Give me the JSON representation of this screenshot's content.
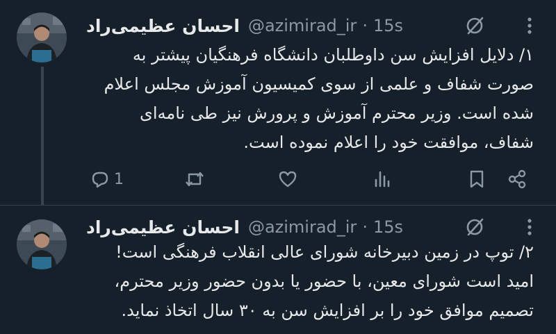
{
  "tweets": [
    {
      "author_name": "احسان عظیمی‌راد",
      "handle": "@azimirad_ir",
      "separator": "·",
      "time": "15s",
      "text": "۱/ دلایل افزایش سن داوطلبان دانشگاه فرهنگیان پیشتر به\nصورت شفاف و علمی از سوی کمیسیون آموزش مجلس اعلام\nشده است. وزیر محترم آموزش و پرورش نیز طی نامه‌ای\nشفاف، موافقت خود را اعلام نموده است.",
      "reply_count": "1",
      "icons": [
        "grok-icon",
        "more-icon",
        "reply-icon",
        "retweet-icon",
        "like-icon",
        "views-icon",
        "bookmark-icon",
        "share-icon"
      ]
    },
    {
      "author_name": "احسان عظیمی‌راد",
      "handle": "@azimirad_ir",
      "separator": "·",
      "time": "15s",
      "text": "۲/ توپ در زمین دبیرخانه شورای عالی انقلاب فرهنگی است!\nامید است شورای معین، با حضور یا بدون حضور وزیر محترم،\nتصمیم موافق خود را بر افزایش سن به ۳۰ سال اتخاذ نماید.",
      "icons": [
        "grok-icon",
        "more-icon"
      ]
    }
  ],
  "colors": {
    "background": "#15202b",
    "text": "#e7e9ea",
    "secondary": "#8b98a5",
    "divider": "#38444d"
  }
}
